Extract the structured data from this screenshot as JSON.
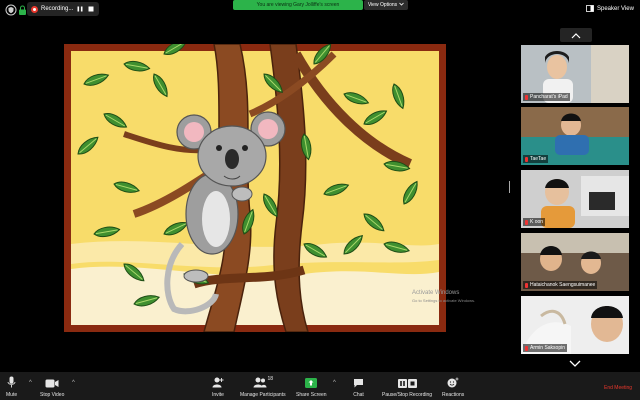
{
  "topbar": {
    "recording_label": "Recording...",
    "viewing_text": "You are viewing Gary Jolliffe's screen",
    "view_options_label": "View Options",
    "speaker_view_label": "Speaker View"
  },
  "watermark": {
    "title": "Activate Windows",
    "subtitle": "Go to Settings to activate Windows."
  },
  "gallery": {
    "participants": [
      {
        "name": "Pancharat's iPad"
      },
      {
        "name": "TaeTae"
      },
      {
        "name": "K oon"
      },
      {
        "name": "Hataichanok Saengsuimanee"
      },
      {
        "name": "Armin Saksopin"
      }
    ]
  },
  "toolbar": {
    "mute_label": "Mute",
    "stop_video_label": "Stop Video",
    "invite_label": "Invite",
    "manage_participants_label": "Manage Participants",
    "participants_count": "18",
    "share_screen_label": "Share Screen",
    "chat_label": "Chat",
    "pause_stop_recording_label": "Pause/Stop Recording",
    "reactions_label": "Reactions",
    "end_meeting_label": "End Meeting"
  },
  "colors": {
    "recording_red": "#e8372c",
    "share_green": "#2cb34a",
    "end_meeting_red": "#e8372c",
    "toolbar_bg": "#1a1a1a"
  }
}
